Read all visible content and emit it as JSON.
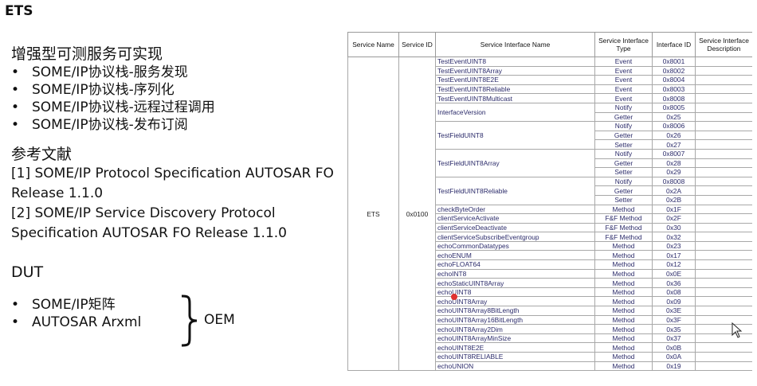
{
  "slide": {
    "title": "ETS"
  },
  "section1": {
    "heading": "增强型可测服务可实现",
    "bullets": [
      "SOME/IP协议栈-服务发现",
      "SOME/IP协议栈-序列化",
      "SOME/IP协议栈-远程过程调用",
      "SOME/IP协议栈-发布订阅"
    ]
  },
  "references": {
    "heading": "参考文献",
    "lines": [
      "[1] SOME/IP Protocol Specification AUTOSAR FO",
      "Release 1.1.0",
      "[2] SOME/IP Service Discovery Protocol",
      "Specification AUTOSAR FO Release 1.1.0"
    ]
  },
  "dut": {
    "heading": "DUT",
    "bullets": [
      "SOME/IP矩阵",
      "AUTOSAR Arxml"
    ],
    "group_label": "OEM"
  },
  "table": {
    "headers": [
      "Service Name",
      "Service ID",
      "Service Interface Name",
      "Service Interface Type",
      "Interface ID",
      "Service Interface Description"
    ],
    "service_name": "ETS",
    "service_id": "0x0100",
    "rows": [
      {
        "name": "TestEventUINT8",
        "type": "Event",
        "id": "0x8001"
      },
      {
        "name": "TestEventUINT8Array",
        "type": "Event",
        "id": "0x8002"
      },
      {
        "name": "TestEventUINT8E2E",
        "type": "Event",
        "id": "0x8004"
      },
      {
        "name": "TestEventUINT8Reliable",
        "type": "Event",
        "id": "0x8003"
      },
      {
        "name": "TestEventUINT8Multicast",
        "type": "Event",
        "id": "0x8008"
      },
      {
        "name": "InterfaceVersion",
        "type": "Notify",
        "id": "0x8005"
      },
      {
        "name": "",
        "type": "Getter",
        "id": "0x25"
      },
      {
        "name": "TestFieldUINT8",
        "type": "Notify",
        "id": "0x8006"
      },
      {
        "name": "",
        "type": "Getter",
        "id": "0x26"
      },
      {
        "name": "",
        "type": "Setter",
        "id": "0x27"
      },
      {
        "name": "TestFieldUINT8Array",
        "type": "Notify",
        "id": "0x8007"
      },
      {
        "name": "",
        "type": "Getter",
        "id": "0x28"
      },
      {
        "name": "",
        "type": "Setter",
        "id": "0x29"
      },
      {
        "name": "TestFieldUINT8Reliable",
        "type": "Notify",
        "id": "0x8008"
      },
      {
        "name": "",
        "type": "Getter",
        "id": "0x2A"
      },
      {
        "name": "",
        "type": "Setter",
        "id": "0x2B"
      },
      {
        "name": "checkByteOrder",
        "type": "Method",
        "id": "0x1F"
      },
      {
        "name": "clientServiceActivate",
        "type": "F&F Method",
        "id": "0x2F"
      },
      {
        "name": "clientServiceDeactivate",
        "type": "F&F Method",
        "id": "0x30"
      },
      {
        "name": "clientServiceSubscribeEventgroup",
        "type": "F&F Method",
        "id": "0x32"
      },
      {
        "name": "echoCommonDatatypes",
        "type": "Method",
        "id": "0x23"
      },
      {
        "name": "echoENUM",
        "type": "Method",
        "id": "0x17"
      },
      {
        "name": "echoFLOAT64",
        "type": "Method",
        "id": "0x12"
      },
      {
        "name": "echoINT8",
        "type": "Method",
        "id": "0x0E"
      },
      {
        "name": "echoStaticUINT8Array",
        "type": "Method",
        "id": "0x36"
      },
      {
        "name": "echoUINT8",
        "type": "Method",
        "id": "0x08"
      },
      {
        "name": "echoUINT8Array",
        "type": "Method",
        "id": "0x09"
      },
      {
        "name": "echoUINT8Array8BitLength",
        "type": "Method",
        "id": "0x3E"
      },
      {
        "name": "echoUINT8Array16BitLength",
        "type": "Method",
        "id": "0x3F"
      },
      {
        "name": "echoUINT8Array2Dim",
        "type": "Method",
        "id": "0x35"
      },
      {
        "name": "echoUINT8ArrayMinSize",
        "type": "Method",
        "id": "0x37"
      },
      {
        "name": "echoUINT8E2E",
        "type": "Method",
        "id": "0x0B"
      },
      {
        "name": "echoUINT8RELIABLE",
        "type": "Method",
        "id": "0x0A"
      },
      {
        "name": "echoUNION",
        "type": "Method",
        "id": "0x19"
      }
    ]
  },
  "colors": {
    "text": "#111111",
    "cell_text": "#2b2b6a",
    "grid": "#a8a8a8",
    "record_dot": "#e03030"
  }
}
